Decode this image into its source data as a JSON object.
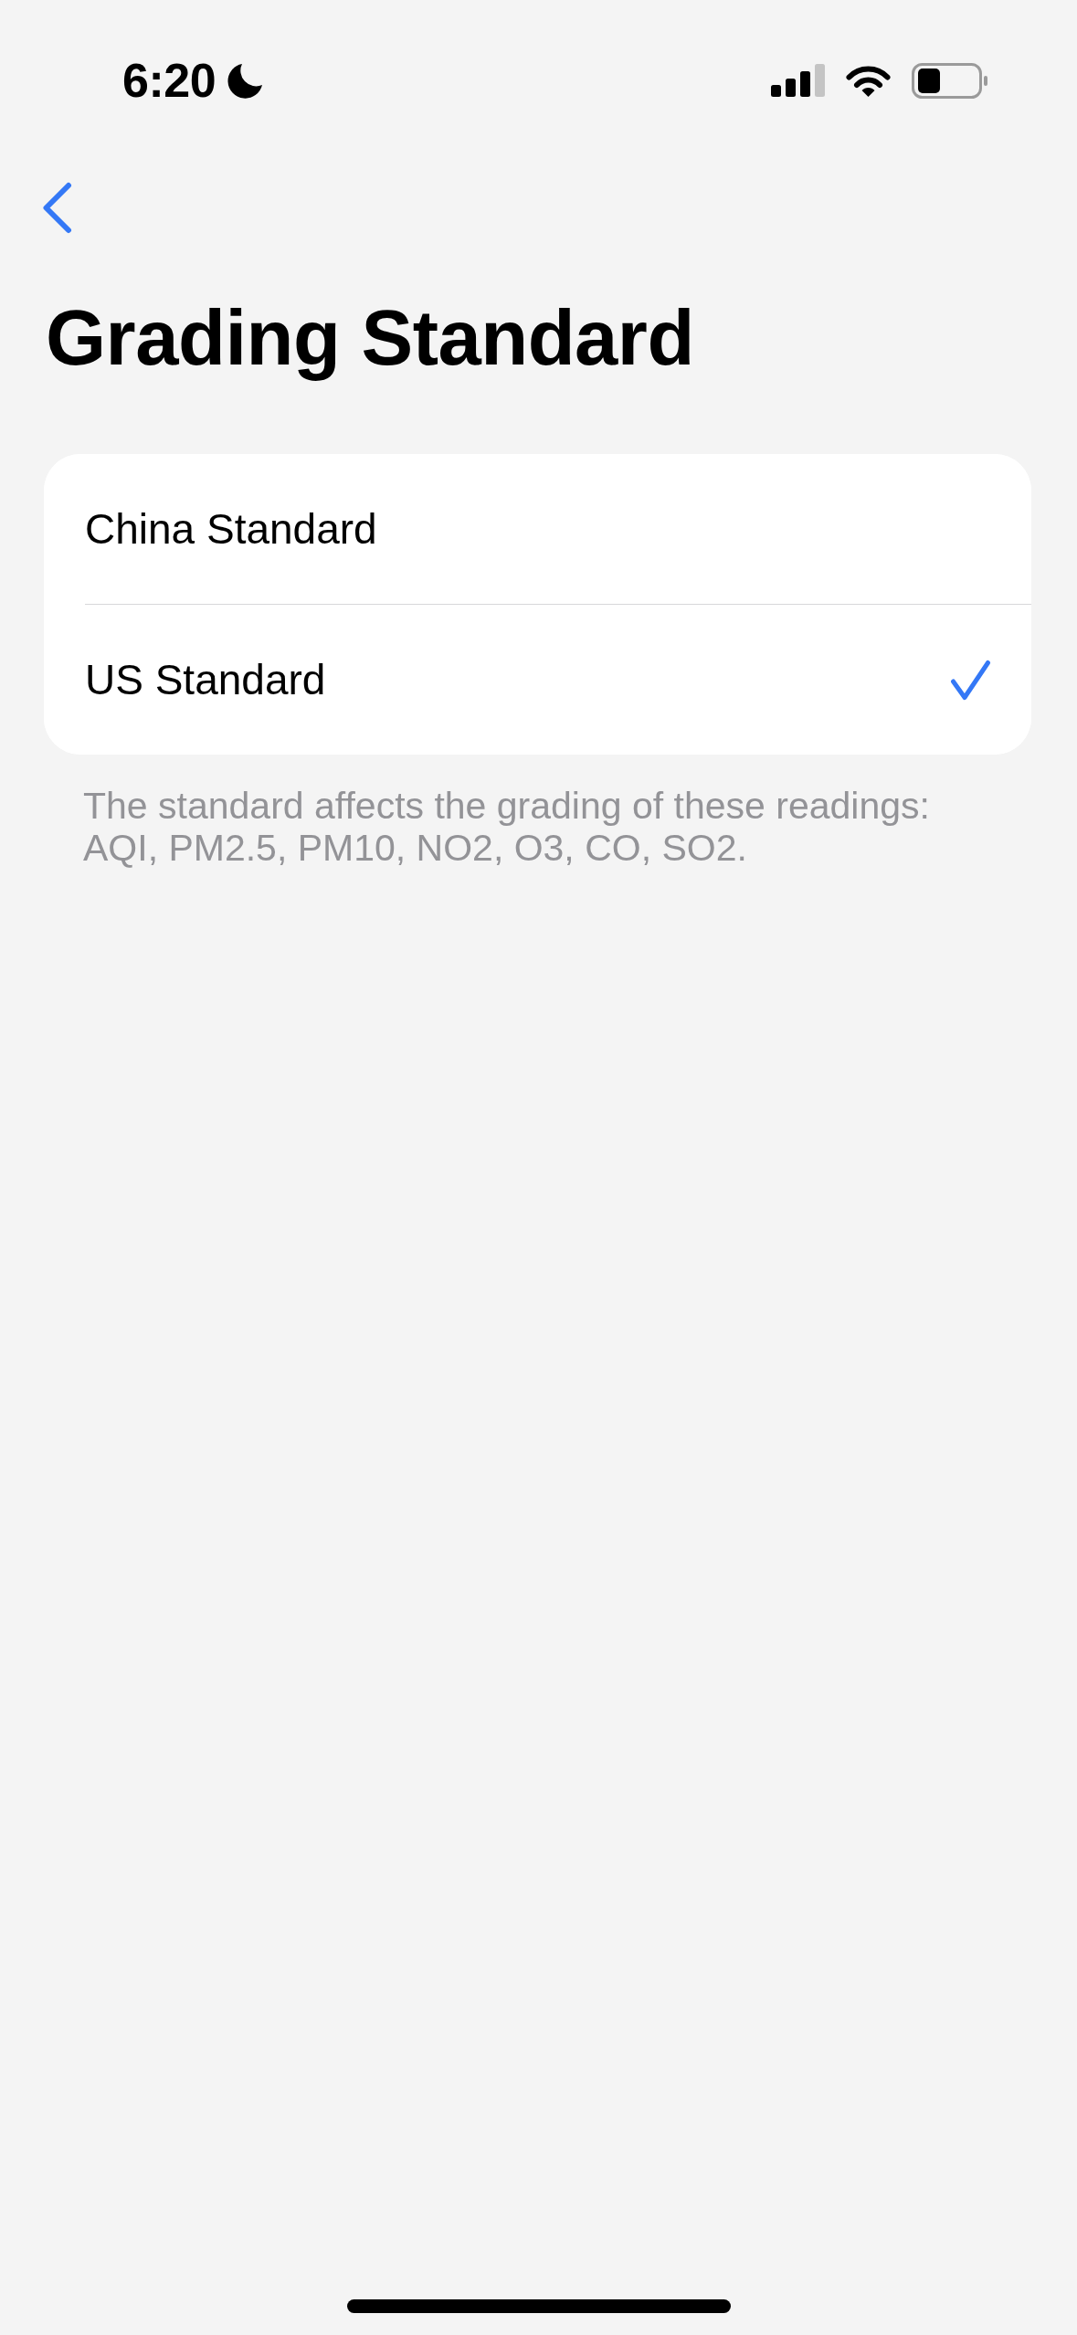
{
  "status_bar": {
    "time": "6:20"
  },
  "title": "Grading Standard",
  "options": [
    {
      "label": "China Standard",
      "selected": false
    },
    {
      "label": "US Standard",
      "selected": true
    }
  ],
  "footer": "The standard affects the grading of these readings: AQI, PM2.5, PM10, NO2, O3, CO, SO2."
}
